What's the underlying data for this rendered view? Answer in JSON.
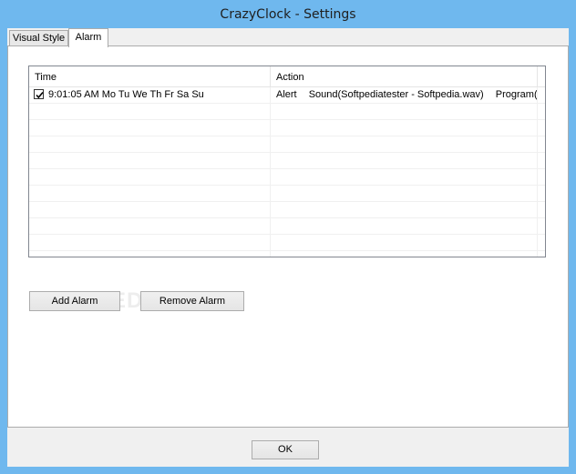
{
  "window": {
    "title": "CrazyClock - Settings"
  },
  "tabs": [
    {
      "label": "Visual Style",
      "active": false
    },
    {
      "label": "Alarm",
      "active": true
    }
  ],
  "alarm_list": {
    "columns": [
      "Time",
      "Action"
    ],
    "rows": [
      {
        "checked": true,
        "time": "9:01:05 AM Mo Tu We Th Fr Sa Su",
        "action": [
          "Alert",
          "Sound(Softpediatester - Softpedia.wav)",
          "Program(..."
        ]
      }
    ]
  },
  "buttons": {
    "add_alarm": "Add Alarm",
    "remove_alarm": "Remove Alarm",
    "ok": "OK"
  },
  "watermark": "SOFTPEDIA",
  "colors": {
    "titlebar": "#6fb8ee",
    "client": "#f0f0f0"
  }
}
